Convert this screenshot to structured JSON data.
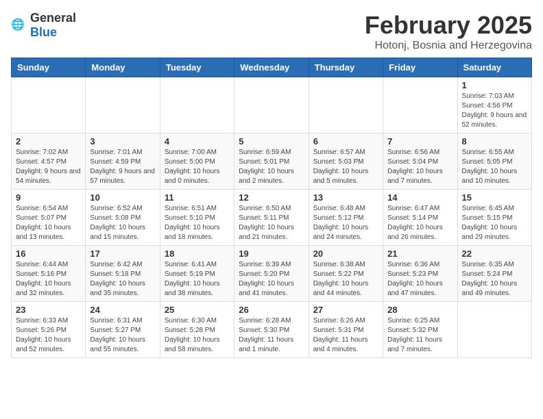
{
  "header": {
    "logo_general": "General",
    "logo_blue": "Blue",
    "month": "February 2025",
    "location": "Hotonj, Bosnia and Herzegovina"
  },
  "weekdays": [
    "Sunday",
    "Monday",
    "Tuesday",
    "Wednesday",
    "Thursday",
    "Friday",
    "Saturday"
  ],
  "weeks": [
    [
      {
        "day": "",
        "info": ""
      },
      {
        "day": "",
        "info": ""
      },
      {
        "day": "",
        "info": ""
      },
      {
        "day": "",
        "info": ""
      },
      {
        "day": "",
        "info": ""
      },
      {
        "day": "",
        "info": ""
      },
      {
        "day": "1",
        "info": "Sunrise: 7:03 AM\nSunset: 4:56 PM\nDaylight: 9 hours and 52 minutes."
      }
    ],
    [
      {
        "day": "2",
        "info": "Sunrise: 7:02 AM\nSunset: 4:57 PM\nDaylight: 9 hours and 54 minutes."
      },
      {
        "day": "3",
        "info": "Sunrise: 7:01 AM\nSunset: 4:59 PM\nDaylight: 9 hours and 57 minutes."
      },
      {
        "day": "4",
        "info": "Sunrise: 7:00 AM\nSunset: 5:00 PM\nDaylight: 10 hours and 0 minutes."
      },
      {
        "day": "5",
        "info": "Sunrise: 6:59 AM\nSunset: 5:01 PM\nDaylight: 10 hours and 2 minutes."
      },
      {
        "day": "6",
        "info": "Sunrise: 6:57 AM\nSunset: 5:03 PM\nDaylight: 10 hours and 5 minutes."
      },
      {
        "day": "7",
        "info": "Sunrise: 6:56 AM\nSunset: 5:04 PM\nDaylight: 10 hours and 7 minutes."
      },
      {
        "day": "8",
        "info": "Sunrise: 6:55 AM\nSunset: 5:05 PM\nDaylight: 10 hours and 10 minutes."
      }
    ],
    [
      {
        "day": "9",
        "info": "Sunrise: 6:54 AM\nSunset: 5:07 PM\nDaylight: 10 hours and 13 minutes."
      },
      {
        "day": "10",
        "info": "Sunrise: 6:52 AM\nSunset: 5:08 PM\nDaylight: 10 hours and 15 minutes."
      },
      {
        "day": "11",
        "info": "Sunrise: 6:51 AM\nSunset: 5:10 PM\nDaylight: 10 hours and 18 minutes."
      },
      {
        "day": "12",
        "info": "Sunrise: 6:50 AM\nSunset: 5:11 PM\nDaylight: 10 hours and 21 minutes."
      },
      {
        "day": "13",
        "info": "Sunrise: 6:48 AM\nSunset: 5:12 PM\nDaylight: 10 hours and 24 minutes."
      },
      {
        "day": "14",
        "info": "Sunrise: 6:47 AM\nSunset: 5:14 PM\nDaylight: 10 hours and 26 minutes."
      },
      {
        "day": "15",
        "info": "Sunrise: 6:45 AM\nSunset: 5:15 PM\nDaylight: 10 hours and 29 minutes."
      }
    ],
    [
      {
        "day": "16",
        "info": "Sunrise: 6:44 AM\nSunset: 5:16 PM\nDaylight: 10 hours and 32 minutes."
      },
      {
        "day": "17",
        "info": "Sunrise: 6:42 AM\nSunset: 5:18 PM\nDaylight: 10 hours and 35 minutes."
      },
      {
        "day": "18",
        "info": "Sunrise: 6:41 AM\nSunset: 5:19 PM\nDaylight: 10 hours and 38 minutes."
      },
      {
        "day": "19",
        "info": "Sunrise: 6:39 AM\nSunset: 5:20 PM\nDaylight: 10 hours and 41 minutes."
      },
      {
        "day": "20",
        "info": "Sunrise: 6:38 AM\nSunset: 5:22 PM\nDaylight: 10 hours and 44 minutes."
      },
      {
        "day": "21",
        "info": "Sunrise: 6:36 AM\nSunset: 5:23 PM\nDaylight: 10 hours and 47 minutes."
      },
      {
        "day": "22",
        "info": "Sunrise: 6:35 AM\nSunset: 5:24 PM\nDaylight: 10 hours and 49 minutes."
      }
    ],
    [
      {
        "day": "23",
        "info": "Sunrise: 6:33 AM\nSunset: 5:26 PM\nDaylight: 10 hours and 52 minutes."
      },
      {
        "day": "24",
        "info": "Sunrise: 6:31 AM\nSunset: 5:27 PM\nDaylight: 10 hours and 55 minutes."
      },
      {
        "day": "25",
        "info": "Sunrise: 6:30 AM\nSunset: 5:28 PM\nDaylight: 10 hours and 58 minutes."
      },
      {
        "day": "26",
        "info": "Sunrise: 6:28 AM\nSunset: 5:30 PM\nDaylight: 11 hours and 1 minute."
      },
      {
        "day": "27",
        "info": "Sunrise: 6:26 AM\nSunset: 5:31 PM\nDaylight: 11 hours and 4 minutes."
      },
      {
        "day": "28",
        "info": "Sunrise: 6:25 AM\nSunset: 5:32 PM\nDaylight: 11 hours and 7 minutes."
      },
      {
        "day": "",
        "info": ""
      }
    ]
  ]
}
